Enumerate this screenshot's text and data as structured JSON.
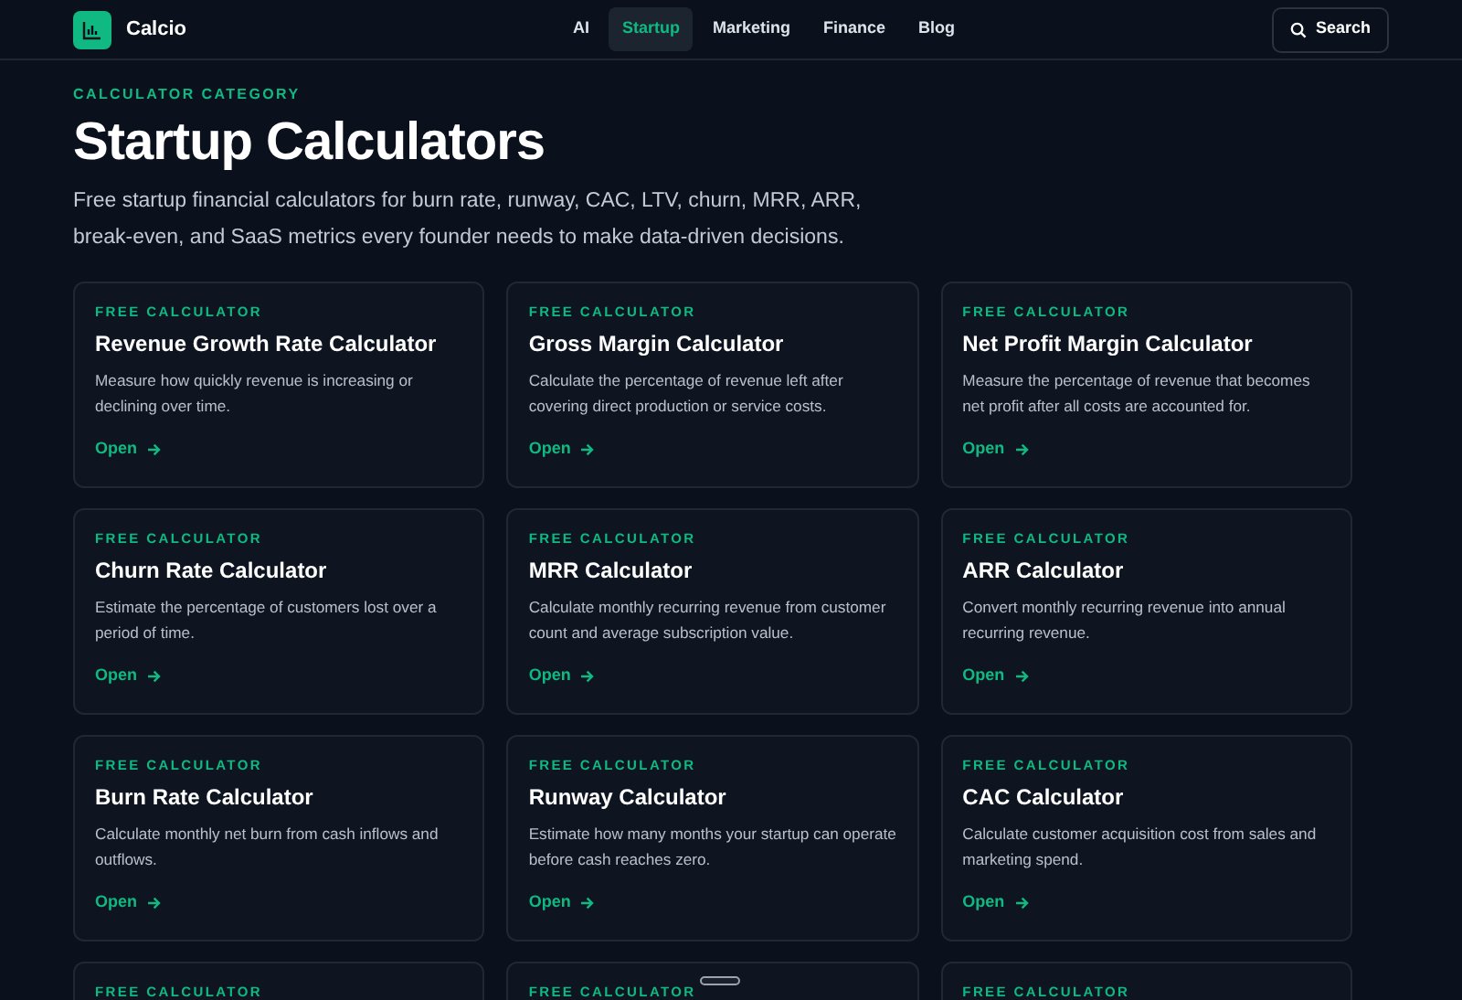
{
  "header": {
    "brand": "Calcio",
    "nav": [
      {
        "label": "AI",
        "selected": false
      },
      {
        "label": "Startup",
        "selected": true
      },
      {
        "label": "Marketing",
        "selected": false
      },
      {
        "label": "Finance",
        "selected": false
      },
      {
        "label": "Blog",
        "selected": false
      }
    ],
    "search_button": "Search"
  },
  "eyebrow": "CALCULATOR CATEGORY",
  "title": "Startup Calculators",
  "intro": "Free startup financial calculators for burn rate, runway, CAC, LTV, churn, MRR, ARR, break-even, and SaaS metrics every founder needs to make data-driven decisions.",
  "cards": [
    {
      "tag": "FREE CALCULATOR",
      "title": "Revenue Growth Rate Calculator",
      "description": "Measure how quickly revenue is increasing or declining over time.",
      "link": "Open"
    },
    {
      "tag": "FREE CALCULATOR",
      "title": "Gross Margin Calculator",
      "description": "Calculate the percentage of revenue left after covering direct production or service costs.",
      "link": "Open"
    },
    {
      "tag": "FREE CALCULATOR",
      "title": "Net Profit Margin Calculator",
      "description": "Measure the percentage of revenue that becomes net profit after all costs are accounted for.",
      "link": "Open"
    },
    {
      "tag": "FREE CALCULATOR",
      "title": "Churn Rate Calculator",
      "description": "Estimate the percentage of customers lost over a period of time.",
      "link": "Open"
    },
    {
      "tag": "FREE CALCULATOR",
      "title": "MRR Calculator",
      "description": "Calculate monthly recurring revenue from customer count and average subscription value.",
      "link": "Open"
    },
    {
      "tag": "FREE CALCULATOR",
      "title": "ARR Calculator",
      "description": "Convert monthly recurring revenue into annual recurring revenue.",
      "link": "Open"
    },
    {
      "tag": "FREE CALCULATOR",
      "title": "Burn Rate Calculator",
      "description": "Calculate monthly net burn from cash inflows and outflows.",
      "link": "Open"
    },
    {
      "tag": "FREE CALCULATOR",
      "title": "Runway Calculator",
      "description": "Estimate how many months your startup can operate before cash reaches zero.",
      "link": "Open"
    },
    {
      "tag": "FREE CALCULATOR",
      "title": "CAC Calculator",
      "description": "Calculate customer acquisition cost from sales and marketing spend.",
      "link": "Open"
    },
    {
      "tag": "FREE CALCULATOR"
    },
    {
      "tag": "FREE CALCULATOR"
    },
    {
      "tag": "FREE CALCULATOR"
    }
  ]
}
